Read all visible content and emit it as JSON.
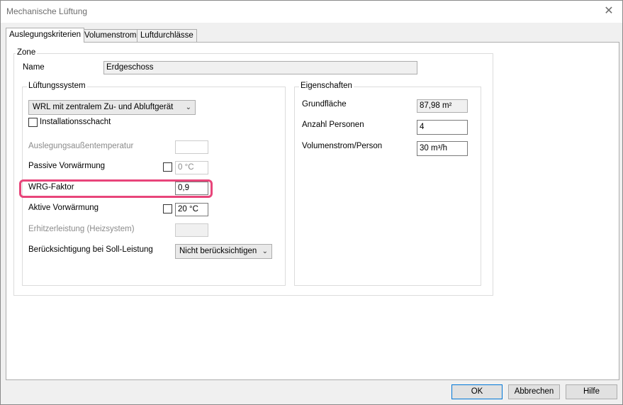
{
  "window": {
    "title": "Mechanische Lüftung",
    "close_glyph": "✕"
  },
  "tabs": [
    {
      "label": "Auslegungskriterien",
      "active": true
    },
    {
      "label": "Volumenstrom",
      "active": false
    },
    {
      "label": "Luftdurchlässe",
      "active": false
    }
  ],
  "zone": {
    "legend": "Zone",
    "name_label": "Name",
    "name_value": "Erdgeschoss"
  },
  "lueftungssystem": {
    "legend": "Lüftungssystem",
    "system_combo_value": "WRL mit zentralem Zu- und Abluftgerät",
    "installationsschacht_label": "Installationsschacht",
    "installationsschacht_checked": false,
    "auslegungstemp_label": "Auslegungsaußentemperatur",
    "auslegungstemp_value": "",
    "passive_label": "Passive Vorwärmung",
    "passive_checked": false,
    "passive_value": "0 °C",
    "wrg_label": "WRG-Faktor",
    "wrg_value": "0,9",
    "aktive_label": "Aktive Vorwärmung",
    "aktive_checked": false,
    "aktive_value": "20 °C",
    "erhitzer_label": "Erhitzerleistung (Heizsystem)",
    "erhitzer_value": "",
    "soll_label": "Berücksichtigung bei Soll-Leistung",
    "soll_combo_value": "Nicht berücksichtigen"
  },
  "eigenschaften": {
    "legend": "Eigenschaften",
    "grundflaeche_label": "Grundfläche",
    "grundflaeche_value": "87,98 m²",
    "personen_label": "Anzahl Personen",
    "personen_value": "4",
    "volumenstrom_label": "Volumenstrom/Person",
    "volumenstrom_value": "30 m³/h"
  },
  "buttons": {
    "ok": "OK",
    "cancel": "Abbrechen",
    "help": "Hilfe"
  },
  "colors": {
    "highlight": "#e8457a",
    "default_button_border": "#0078d7"
  },
  "icons": {
    "combo_arrow": "chevron-down-icon",
    "close": "close-icon"
  }
}
